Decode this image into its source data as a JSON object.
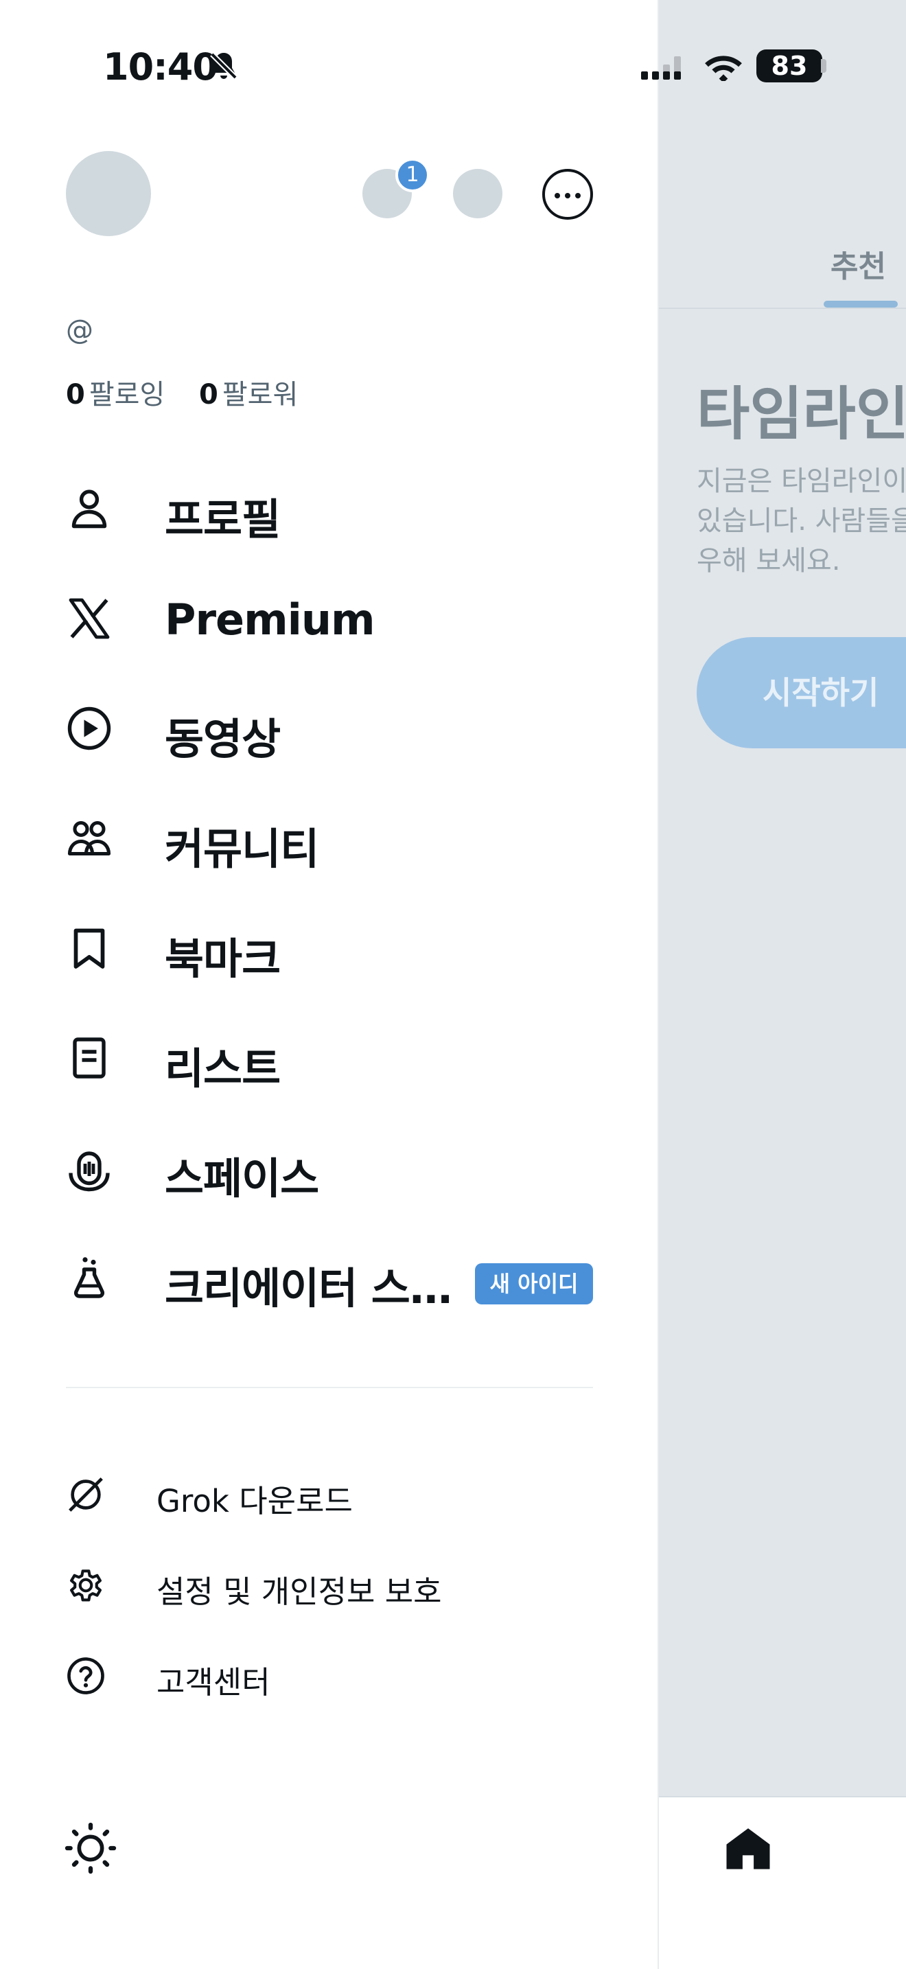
{
  "status_bar": {
    "time": "10:40",
    "battery": "83"
  },
  "account": {
    "handle": "@",
    "following_count": "0",
    "following_label": "팔로잉",
    "followers_count": "0",
    "followers_label": "팔로워",
    "switcher_badge": "1"
  },
  "menu": [
    {
      "label": "프로필",
      "icon": "person-icon"
    },
    {
      "label": "Premium",
      "icon": "x-logo-icon"
    },
    {
      "label": "동영상",
      "icon": "play-icon"
    },
    {
      "label": "커뮤니티",
      "icon": "people-icon"
    },
    {
      "label": "북마크",
      "icon": "bookmark-icon"
    },
    {
      "label": "리스트",
      "icon": "list-icon"
    },
    {
      "label": "스페이스",
      "icon": "microphone-icon"
    },
    {
      "label": "크리에이터 스…",
      "icon": "flask-icon",
      "badge": "새 아이디"
    }
  ],
  "secondary_menu": [
    {
      "label": "Grok 다운로드",
      "icon": "grok-icon"
    },
    {
      "label": "설정 및 개인정보 보호",
      "icon": "gear-icon"
    },
    {
      "label": "고객센터",
      "icon": "help-icon"
    }
  ],
  "background": {
    "tab_label": "추천",
    "title": "타임라인",
    "description": "지금은 타임라인이 비어 있습니다. 사람들을 팔로우해 보세요.",
    "start_button": "시작하기"
  },
  "colors": {
    "accent": "#4a90d9",
    "text": "#0f1419",
    "secondary_text": "#536471"
  }
}
